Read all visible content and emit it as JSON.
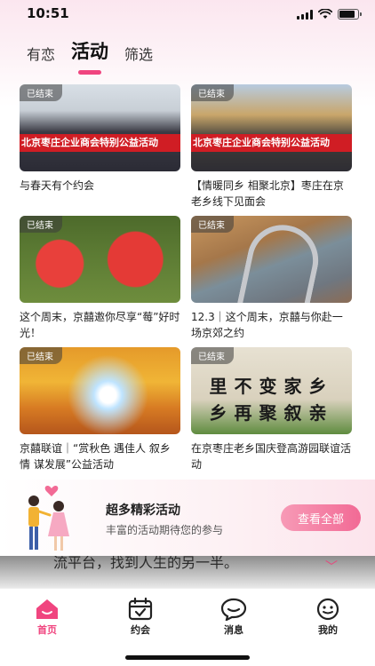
{
  "status_bar": {
    "time": "10:51",
    "battery_level": 0.85
  },
  "top_tabs": [
    {
      "label": "有恋",
      "active": false
    },
    {
      "label": "活动",
      "active": true
    },
    {
      "label": "筛选",
      "active": false
    }
  ],
  "status_badge": "已结束",
  "activities": [
    {
      "title": "与春天有个约会",
      "banner": "北京枣庄企业商会特别公益活动",
      "image": "group-photo"
    },
    {
      "title": "【情暖同乡 相聚北京】枣庄在京老乡线下见面会",
      "banner": "北京枣庄企业商会特别公益活动",
      "image": "group-photo-gate"
    },
    {
      "title": "这个周末，京囍邀你尽享“莓”好时光！",
      "image": "strawberry-baskets"
    },
    {
      "title": "12.3｜这个周末，京囍与你赴一场京郊之约",
      "image": "mountain-road"
    },
    {
      "title": "京囍联谊｜“赏秋色 遇佳人 叙乡情 谋发展”公益活动",
      "image": "autumn-tree"
    },
    {
      "title": "在京枣庄老乡国庆登高游园联谊活动",
      "calligraphy_lines": [
        "里不变家乡",
        "乡再聚叙亲"
      ],
      "image": "calligraphy-landscape"
    }
  ],
  "promo": {
    "title": "超多精彩活动",
    "subtitle": "丰富的活动期待您的参与",
    "button": "查看全部"
  },
  "peek_text": "流平台，找到人生的另一半。",
  "bottom_nav": [
    {
      "label": "首页",
      "icon": "home-icon",
      "active": true
    },
    {
      "label": "约会",
      "icon": "calendar-icon",
      "active": false
    },
    {
      "label": "消息",
      "icon": "chat-bubble-icon",
      "active": false
    },
    {
      "label": "我的",
      "icon": "profile-face-icon",
      "active": false
    }
  ],
  "colors": {
    "accent": "#f0457f",
    "banner_red": "#d01d24"
  }
}
